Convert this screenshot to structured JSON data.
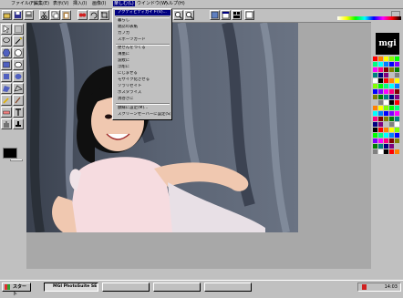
{
  "menubar": {
    "items": [
      {
        "label": "ファイル(F)"
      },
      {
        "label": "編集(E)"
      },
      {
        "label": "表示(V)"
      },
      {
        "label": "挿入(I)"
      },
      {
        "label": "画像(I)"
      },
      {
        "label": "楽しむ(L)"
      },
      {
        "label": "ウインドウ(W)"
      },
      {
        "label": "ヘルプ(H)"
      }
    ]
  },
  "dropdown": {
    "items": [
      {
        "label": "アクティビティガイド(V)..."
      },
      {
        "label": "暮らし"
      },
      {
        "label": "雑誌の表紙"
      },
      {
        "label": "カフカ"
      },
      {
        "label": "スポーツカード"
      },
      {
        "label": "便せんをつくる"
      },
      {
        "label": "薄墨に"
      },
      {
        "label": "波紋に"
      },
      {
        "label": "浮彫に"
      },
      {
        "label": "にじませる"
      },
      {
        "label": "モザイク化させる"
      },
      {
        "label": "ソラリゼイト"
      },
      {
        "label": "ポスタライズ"
      },
      {
        "label": "渦巻きに"
      },
      {
        "label": "額縁に設定(M)..."
      },
      {
        "label": "スクリーンセーバーに設定(S)..."
      }
    ]
  },
  "brand": {
    "logo_text": "mgi"
  },
  "taskbar": {
    "start_label": "スタート",
    "tasks": [
      {
        "label": "MGI PhotoSuite SE"
      },
      {
        "label": ""
      },
      {
        "label": ""
      },
      {
        "label": ""
      }
    ],
    "clock": "14:03"
  },
  "colors": {
    "title_blue": "#000080",
    "face": "#c0c0c0",
    "desktop": "#a8a8a8"
  }
}
